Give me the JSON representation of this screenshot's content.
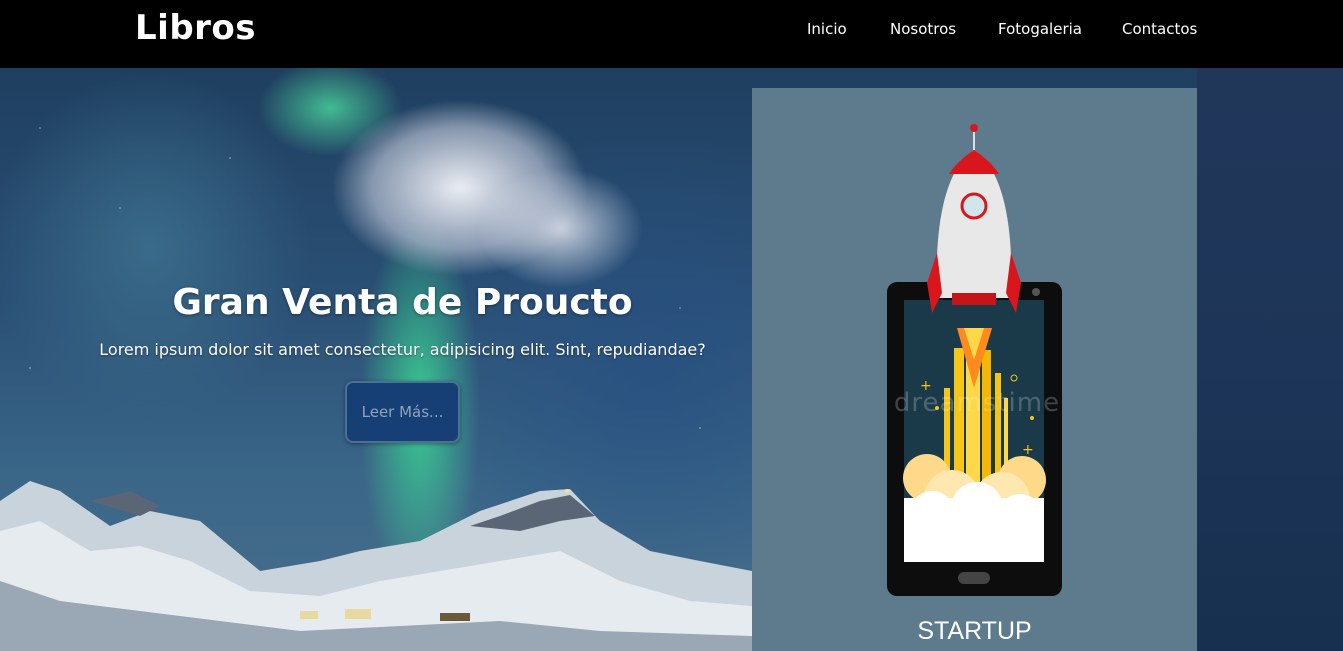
{
  "header": {
    "brand": "Libros",
    "nav": [
      {
        "label": "Inicio"
      },
      {
        "label": "Nosotros"
      },
      {
        "label": "Fotogaleria"
      },
      {
        "label": "Contactos"
      }
    ]
  },
  "hero": {
    "title": "Gran Venta de Proucto",
    "subtitle": "Lorem ipsum dolor sit amet consectetur, adipisicing elit. Sint, repudiandae?",
    "button_label": "Leer Más..."
  },
  "card": {
    "caption": "STARTUP",
    "watermark": "dreamstime"
  },
  "colors": {
    "navbar": "#000000",
    "button_bg": "#163f76",
    "card_bg": "#5d7b8c"
  }
}
